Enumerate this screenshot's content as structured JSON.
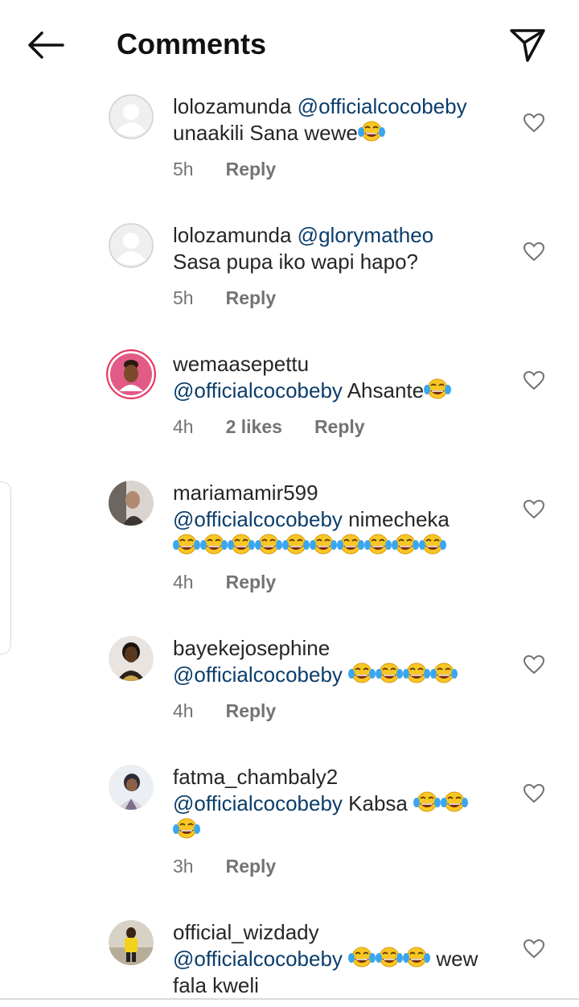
{
  "header": {
    "title": "Comments",
    "back_icon": "back-arrow-icon",
    "share_icon": "paper-plane-icon"
  },
  "comments": [
    {
      "username": "lolozamunda",
      "mention": "@officialcocobeby",
      "text_after": "",
      "line2": "unaakili Sana wewe",
      "emojis": 1,
      "time": "5h",
      "likes": "",
      "reply": "Reply"
    },
    {
      "username": "lolozamunda",
      "mention": "@glorymatheo",
      "text_after": "",
      "line2": "Sasa pupa iko wapi hapo?",
      "emojis": 0,
      "time": "5h",
      "likes": "",
      "reply": "Reply"
    },
    {
      "username": "wemaasepettu",
      "mention": "@officialcocobeby",
      "text_after": " Ahsante",
      "emojis": 1,
      "time": "4h",
      "likes": "2 likes",
      "reply": "Reply"
    },
    {
      "username": "mariamamir599",
      "mention": "@officialcocobeby",
      "text_after": " nimecheka",
      "emojis": 10,
      "time": "4h",
      "likes": "",
      "reply": "Reply"
    },
    {
      "username": "bayekejosephine",
      "mention": "@officialcocobeby",
      "text_after": " ",
      "emojis": 4,
      "time": "4h",
      "likes": "",
      "reply": "Reply"
    },
    {
      "username": "fatma_chambaly2",
      "mention": "@officialcocobeby",
      "text_after": " Kabsa ",
      "emojis": 3,
      "time": "3h",
      "likes": "",
      "reply": "Reply"
    },
    {
      "username": "official_wizdady",
      "mention": "@officialcocobeby",
      "text_after": " ",
      "emojis": 3,
      "text_tail": " wew",
      "line2": "fala kweli",
      "time": "",
      "likes": "",
      "reply": ""
    }
  ]
}
